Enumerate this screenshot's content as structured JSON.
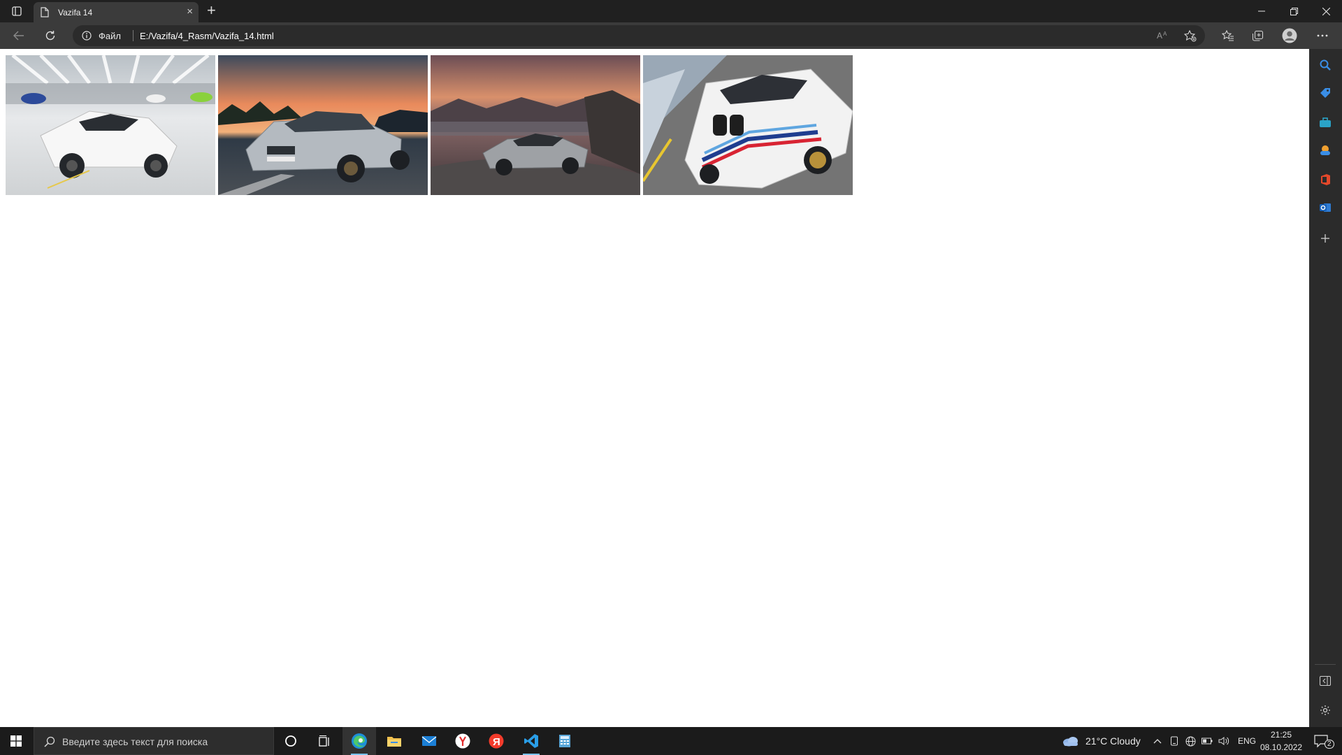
{
  "browser": {
    "tab_title": "Vazifa 14",
    "close_tab_glyph": "×",
    "new_tab_glyph": "+",
    "scheme_label": "Файл",
    "url": "E:/Vazifa/4_Rasm/Vazifa_14.html"
  },
  "page": {
    "images": [
      {
        "subject": "white Lamborghini Huracan in factory hall",
        "colors": [
          "#d9dcdf",
          "#f2f2f2",
          "#3a3f44"
        ]
      },
      {
        "subject": "silver BMW M4 at sunset",
        "colors": [
          "#2f3a46",
          "#e98a5c",
          "#a9afb5"
        ]
      },
      {
        "subject": "silver Mercedes convertible on coastal road at dusk",
        "colors": [
          "#5b4b4f",
          "#d9906b",
          "#8d8f92"
        ]
      },
      {
        "subject": "white BMW 3.0 CSL Hommage R race car",
        "colors": [
          "#6a6a6a",
          "#f2f2f2",
          "#1f3d8f"
        ]
      }
    ]
  },
  "taskbar": {
    "search_placeholder": "Введите здесь текст для поиска",
    "weather": "21°C  Cloudy",
    "language": "ENG",
    "time": "21:25",
    "date": "08.10.2022",
    "notification_count": "2"
  },
  "colors": {
    "titlebar": "#202020",
    "toolbar": "#3b3b3b",
    "page_bg": "#ffffff",
    "sidebar": "#2b2b2b",
    "taskbar": "#1b1b1b",
    "accent": "#78c2f0"
  }
}
